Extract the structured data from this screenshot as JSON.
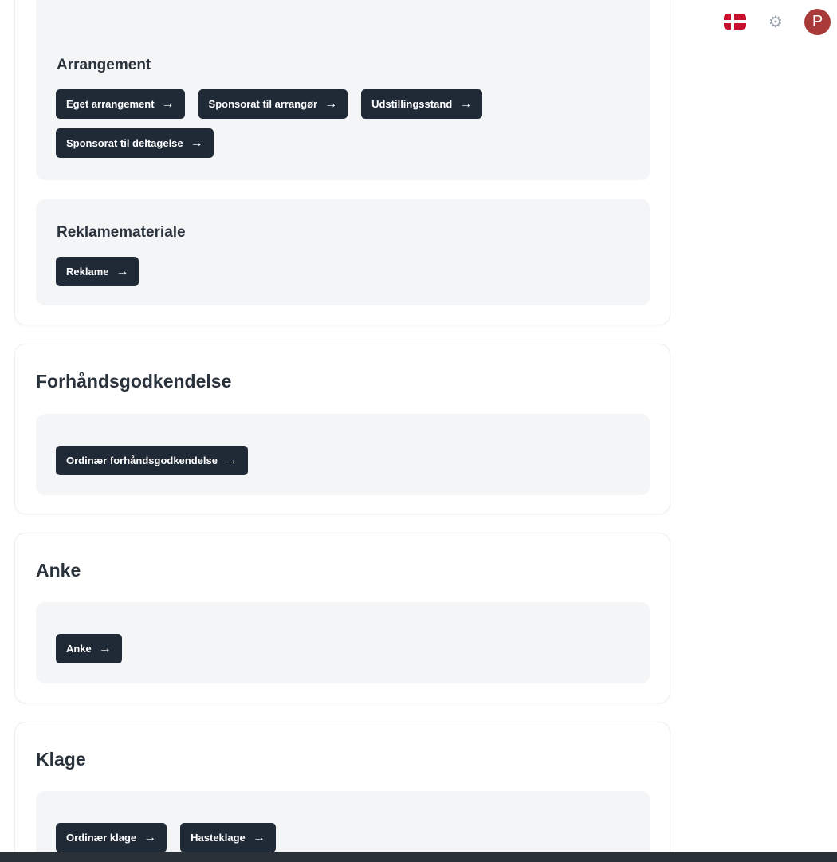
{
  "header": {
    "flag_icon": "danish-flag-icon",
    "settings_icon": "gear-icon",
    "avatar_initial": "P",
    "avatar_color": "#a83a3a"
  },
  "card_top": {
    "sections": [
      {
        "title": "Arrangement",
        "buttons": [
          "Eget arrangement",
          "Sponsorat til arrangør",
          "Udstillingsstand",
          "Sponsorat til deltagelse"
        ]
      },
      {
        "title": "Reklamemateriale",
        "buttons": [
          "Reklame"
        ]
      }
    ]
  },
  "card_forhand": {
    "title": "Forhåndsgodkendelse",
    "buttons": [
      "Ordinær forhåndsgodkendelse"
    ]
  },
  "card_anke": {
    "title": "Anke",
    "buttons": [
      "Anke"
    ]
  },
  "card_klage": {
    "title": "Klage",
    "buttons": [
      "Ordinær klage",
      "Hasteklage"
    ]
  },
  "arrow_glyph": "→",
  "colors": {
    "button_bg": "#1f2a36",
    "panel_bg": "#f4f5f7",
    "flag_red": "#c8102e"
  }
}
